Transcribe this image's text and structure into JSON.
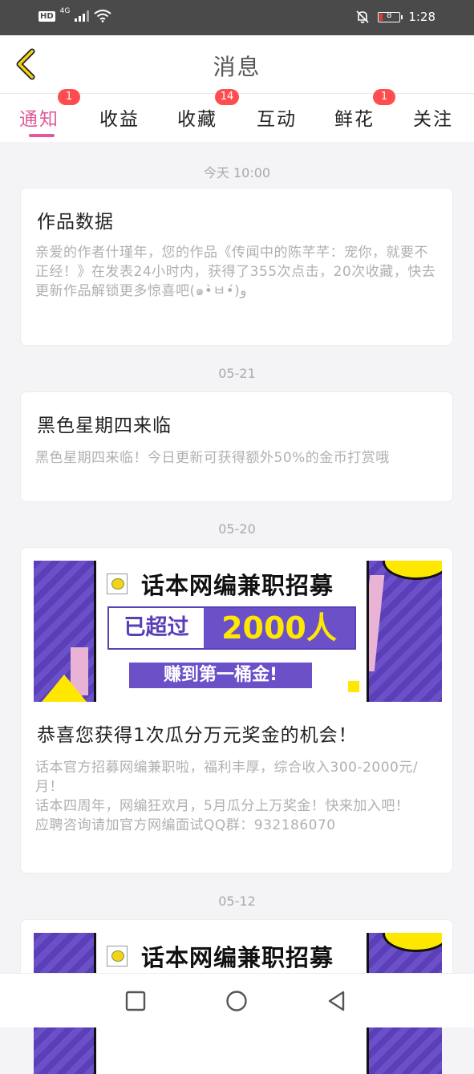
{
  "status_bar": {
    "hd": "HD",
    "network": "4G",
    "battery": "8",
    "time": "1:28"
  },
  "header": {
    "title": "消息",
    "accent_color": "#e05a9a"
  },
  "tabs": [
    {
      "label": "通知",
      "badge": "1",
      "active": true
    },
    {
      "label": "收益",
      "badge": "",
      "active": false
    },
    {
      "label": "收藏",
      "badge": "14",
      "active": false
    },
    {
      "label": "互动",
      "badge": "",
      "active": false
    },
    {
      "label": "鲜花",
      "badge": "1",
      "active": false
    },
    {
      "label": "关注",
      "badge": "",
      "active": false
    }
  ],
  "feed": [
    {
      "date": "今天 10:00",
      "title": "作品数据",
      "body": "亲爱的作者什瑾年，您的作品《传闻中的陈芊芊：宠你，就要不正经！》在发表24小时内，获得了355次点击，20次收藏，快去更新作品解锁更多惊喜吧(๑•̀ㅂ•́)و"
    },
    {
      "date": "05-21",
      "title": "黑色星期四来临",
      "body": "黑色星期四来临！今日更新可获得额外50%的金币打赏哦"
    },
    {
      "date": "05-20",
      "title": "恭喜您获得1次瓜分万元奖金的机会！",
      "body_lines": [
        "话本官方招募网编兼职啦，福利丰厚，综合收入300-2000元/月！",
        "话本四周年，网编狂欢月，5月瓜分上万奖金！快来加入吧！",
        "应聘咨询请加官方网编面试QQ群：932186070"
      ],
      "banner": {
        "title": "话本网编兼职招募",
        "left_text": "已超过",
        "right_text": "2000人",
        "button_text": "赚到第一桶金!"
      }
    },
    {
      "date": "05-12",
      "banner": {
        "title": "话本网编兼职招募"
      }
    }
  ]
}
